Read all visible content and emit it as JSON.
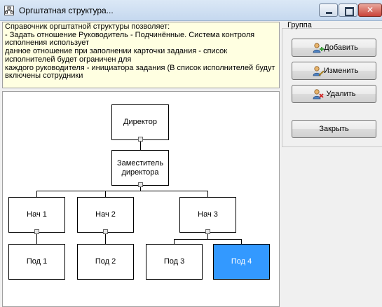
{
  "window": {
    "title": "Оргштатная структура..."
  },
  "info": {
    "lines": [
      "Справочник оргштатной структуры позволяет:",
      "- Задать отношение Руководитель - Подчинённые. Система контроля",
      "исполнения использует",
      "данное отношение при заполнении карточки задания - список",
      "исполнителей будет ограничен для",
      "каждого руководителя - инициатора задания (В список исполнителей будут",
      "включены сотрудники"
    ]
  },
  "org": {
    "director": "Директор",
    "deputy_line1": "Заместитель",
    "deputy_line2": "директора",
    "heads": [
      "Нач 1",
      "Нач 2",
      "Нач 3"
    ],
    "subs": [
      "Под 1",
      "Под 2",
      "Под 3",
      "Под 4"
    ],
    "selected": "Под 4",
    "selected_color": "#3399ff"
  },
  "panel": {
    "group_label": "Группа",
    "add_label": "Добавить",
    "edit_label": "Изменить",
    "delete_label": "Удалить",
    "close_label": "Закрыть"
  },
  "icons": {
    "app": "org-structure-icon",
    "add": "user-add-icon",
    "edit": "user-edit-icon",
    "delete": "user-delete-icon"
  }
}
